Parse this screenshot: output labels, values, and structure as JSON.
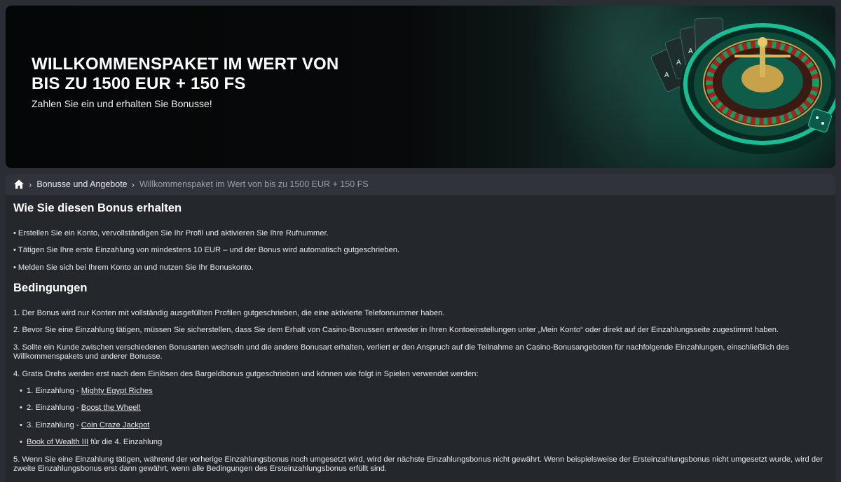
{
  "banner": {
    "title_line1": "WILLKOMMENSPAKET IM WERT VON",
    "title_line2": "BIS ZU 1500 EUR + 150 FS",
    "subtitle": "Zahlen Sie ein und erhalten Sie Bonusse!"
  },
  "breadcrumb": {
    "home_icon": "home-icon",
    "items": [
      {
        "label": "Bonusse und Angebote"
      },
      {
        "label": "Willkommenspaket im Wert von bis zu 1500 EUR + 150 FS"
      }
    ]
  },
  "how_section": {
    "heading": "Wie Sie diesen Bonus erhalten",
    "steps": [
      "Erstellen Sie ein Konto, vervollständigen Sie Ihr Profil und aktivieren Sie Ihre Rufnummer.",
      "Tätigen Sie Ihre erste Einzahlung von mindestens 10 EUR – und der Bonus wird automatisch gutgeschrieben.",
      "Melden Sie sich bei Ihrem Konto an und nutzen Sie Ihr Bonuskonto."
    ]
  },
  "conditions": {
    "heading": "Bedingungen",
    "items": [
      "1. Der Bonus wird nur Konten mit vollständig ausgefüllten Profilen gutgeschrieben, die eine aktivierte Telefonnummer haben.",
      "2. Bevor Sie eine Einzahlung tätigen, müssen Sie sicherstellen, dass Sie dem Erhalt von Casino-Bonussen entweder in Ihren Kontoeinstellungen unter „Mein Konto“ oder direkt auf der Einzahlungsseite zugestimmt haben.",
      "3. Sollte ein Kunde zwischen verschiedenen Bonusarten wechseln und die andere Bonusart erhalten, verliert er den Anspruch auf die Teilnahme an Casino-Bonusangeboten für nachfolgende Einzahlungen, einschließlich des",
      "Willkommenspakets und anderer Bonusse.",
      "4. Gratis Drehs werden erst nach dem Einlösen des Bargeldbonus gutgeschrieben und können wie folgt in Spielen verwendet werden:",
      "5. Wenn Sie eine Einzahlung tätigen, während der vorherige Einzahlungsbonus noch umgesetzt wird, wird der nächste Einzahlungsbonus nicht gewährt. Wenn beispielsweise der Ersteinzahlungsbonus nicht umgesetzt wurde, wird der",
      "zweite Einzahlungsbonus erst dann gewährt, wenn alle Bedingungen des Ersteinzahlungsbonus erfüllt sind."
    ],
    "free_spins": [
      {
        "prefix": "1. Einzahlung - ",
        "game": "Mighty Egypt Riches",
        "suffix": ""
      },
      {
        "prefix": "2. Einzahlung - ",
        "game": "Boost the Wheel!",
        "suffix": ""
      },
      {
        "prefix": "3. Einzahlung - ",
        "game": "Coin Craze Jackpot",
        "suffix": ""
      },
      {
        "prefix": "",
        "game": "Book of Wealth III",
        "suffix": " für die 4. Einzahlung"
      }
    ]
  }
}
